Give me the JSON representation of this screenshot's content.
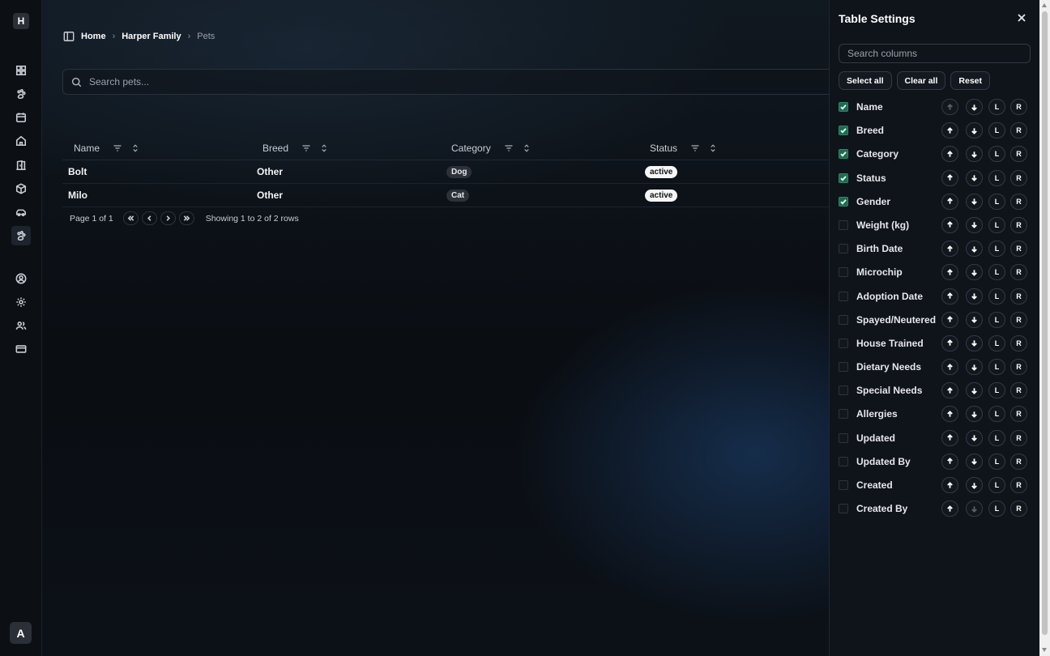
{
  "rail": {
    "logo": "H",
    "avatar": "A",
    "icons": [
      "dashboard-icon",
      "paw-icon",
      "calendar-icon",
      "home-icon",
      "door-icon",
      "package-icon",
      "car-icon",
      "pets-icon",
      "user-circle-icon",
      "settings-icon",
      "users-icon",
      "credit-card-icon"
    ]
  },
  "breadcrumb": {
    "home": "Home",
    "family": "Harper Family",
    "current": "Pets"
  },
  "search": {
    "placeholder": "Search pets..."
  },
  "table": {
    "columns": [
      "Name",
      "Breed",
      "Category",
      "Status"
    ],
    "rows": [
      {
        "name": "Bolt",
        "breed": "Other",
        "category": "Dog",
        "status": "active"
      },
      {
        "name": "Milo",
        "breed": "Other",
        "category": "Cat",
        "status": "active"
      }
    ],
    "page_label": "Page 1 of 1",
    "showing_label": "Showing 1 to 2 of 2 rows"
  },
  "panel": {
    "title": "Table Settings",
    "search_placeholder": "Search columns",
    "select_all": "Select all",
    "clear_all": "Clear all",
    "reset": "Reset",
    "left_label": "L",
    "right_label": "R",
    "columns": [
      {
        "name": "Name",
        "checked": true
      },
      {
        "name": "Breed",
        "checked": true
      },
      {
        "name": "Category",
        "checked": true
      },
      {
        "name": "Status",
        "checked": true
      },
      {
        "name": "Gender",
        "checked": true
      },
      {
        "name": "Weight (kg)",
        "checked": false
      },
      {
        "name": "Birth Date",
        "checked": false
      },
      {
        "name": "Microchip",
        "checked": false
      },
      {
        "name": "Adoption Date",
        "checked": false
      },
      {
        "name": "Spayed/Neutered",
        "checked": false
      },
      {
        "name": "House Trained",
        "checked": false
      },
      {
        "name": "Dietary Needs",
        "checked": false
      },
      {
        "name": "Special Needs",
        "checked": false
      },
      {
        "name": "Allergies",
        "checked": false
      },
      {
        "name": "Updated",
        "checked": false
      },
      {
        "name": "Updated By",
        "checked": false
      },
      {
        "name": "Created",
        "checked": false
      },
      {
        "name": "Created By",
        "checked": false
      }
    ]
  },
  "colors": {
    "accent_check": "#1c6b4f",
    "badge_light": "#f5f6f7",
    "badge_dark": "#2c313a"
  }
}
